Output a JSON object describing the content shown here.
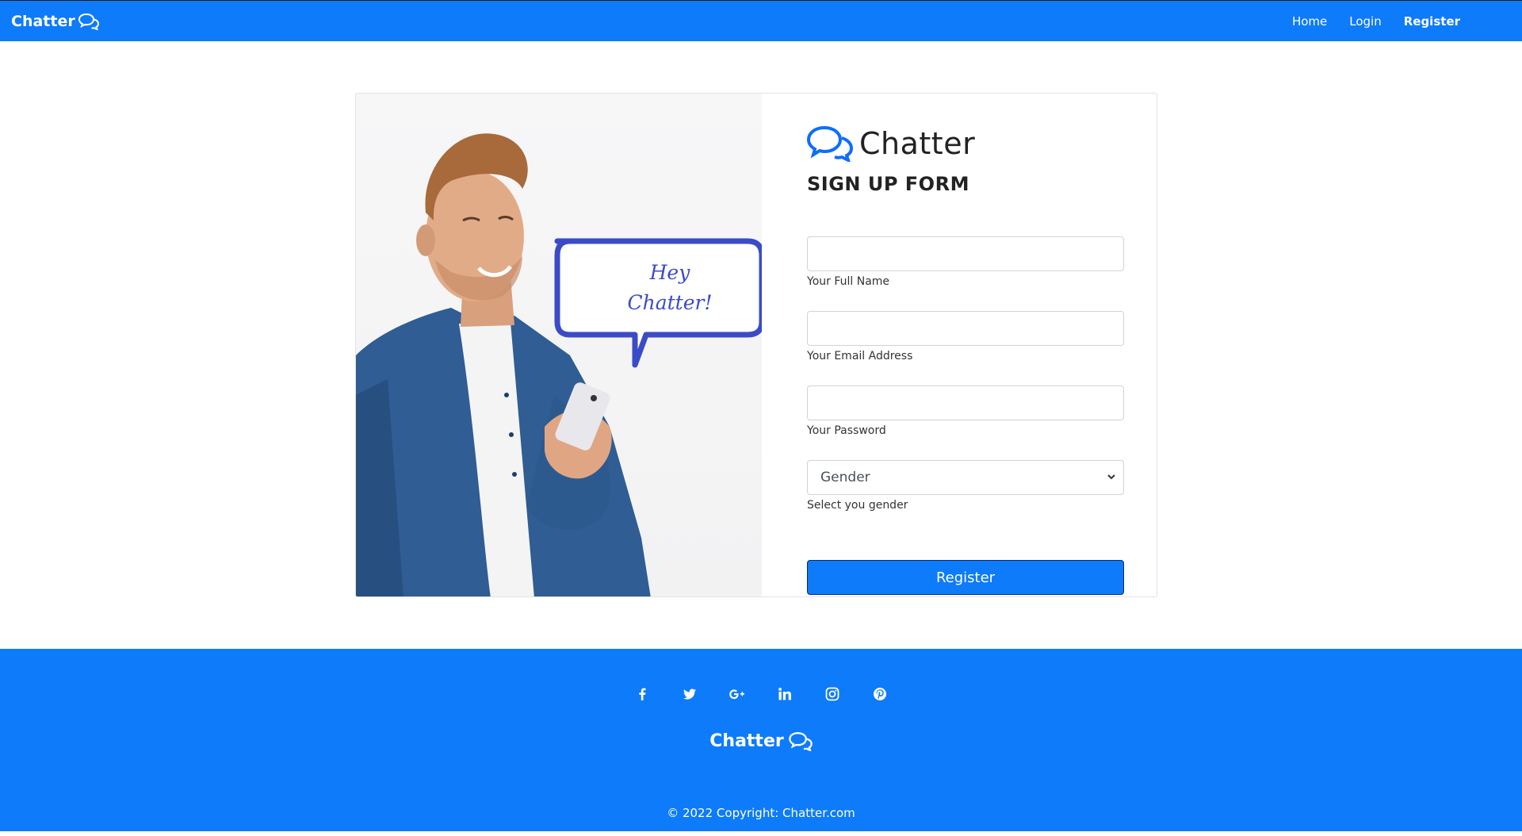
{
  "navbar": {
    "brand": "Chatter",
    "brand_icon": "chat-bubbles-icon",
    "links": [
      {
        "label": "Home"
      },
      {
        "label": "Login"
      },
      {
        "label": "Register"
      }
    ],
    "background": "#0d7bfa"
  },
  "hero": {
    "speech_bubble_line1": "Hey",
    "speech_bubble_line2": "Chatter!",
    "bubble_color": "#3b4bc8"
  },
  "form": {
    "logo_text": "Chatter",
    "logo_icon": "chat-bubbles-icon",
    "title": "SIGN UP FORM",
    "full_name": {
      "value": "",
      "hint": "Your Full Name"
    },
    "email": {
      "value": "",
      "hint": "Your Email Address"
    },
    "password": {
      "value": "",
      "hint": "Your Password"
    },
    "gender": {
      "selected": "Gender",
      "hint": "Select you gender"
    },
    "submit_label": "Register",
    "accent": "#0d7bfa"
  },
  "footer": {
    "socials": [
      "facebook-icon",
      "twitter-icon",
      "google-plus-icon",
      "linkedin-icon",
      "instagram-icon",
      "pinterest-icon"
    ],
    "brand": "Chatter",
    "copyright": "© 2022 Copyright: Chatter.com"
  }
}
